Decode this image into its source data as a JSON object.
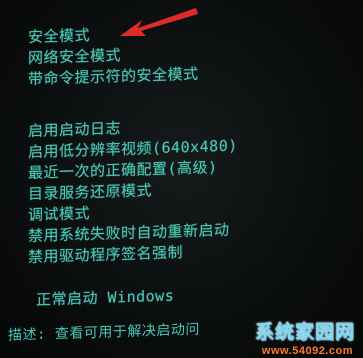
{
  "boot_menu": {
    "items": [
      "安全模式",
      "网络安全模式",
      "带命令提示符的安全模式",
      "启用启动日志",
      "启用低分辨率视频(640x480)",
      "最近一次的正确配置(高级)",
      "目录服务还原模式",
      "调试模式",
      "禁用系统失败时自动重新启动",
      "禁用驱动程序签名强制",
      "正常启动 Windows"
    ],
    "description": "描述: 查看可用于解决启动问"
  },
  "annotation": {
    "arrow_color": "#e02a2a",
    "arrow_icon": "red-arrow-icon"
  },
  "watermark": {
    "logo_text": "系统家园网",
    "url": "www.54092.com"
  },
  "colors": {
    "text": "#49c7b8",
    "background": "#0a0c0c"
  }
}
